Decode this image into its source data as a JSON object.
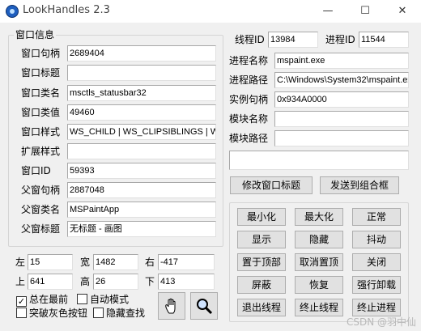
{
  "window": {
    "title": "LookHandles 2.3",
    "minimize_glyph": "—",
    "maximize_glyph": "☐",
    "close_glyph": "✕"
  },
  "window_info": {
    "legend": "窗口信息",
    "rows": [
      {
        "label": "窗口句柄",
        "value": "2689404"
      },
      {
        "label": "窗口标题",
        "value": ""
      },
      {
        "label": "窗口类名",
        "value": "msctls_statusbar32"
      },
      {
        "label": "窗口类值",
        "value": "49460"
      },
      {
        "label": "窗口样式",
        "value": "WS_CHILD | WS_CLIPSIBLINGS | WS_VISIBLE"
      },
      {
        "label": "扩展样式",
        "value": ""
      },
      {
        "label": "窗口ID",
        "value": "59393"
      },
      {
        "label": "父窗句柄",
        "value": "2887048"
      },
      {
        "label": "父窗类名",
        "value": "MSPaintApp"
      },
      {
        "label": "父窗标题",
        "value": "无标题 - 画图"
      }
    ]
  },
  "coords": {
    "left_label": "左",
    "left_value": "15",
    "width_label": "宽",
    "width_value": "1482",
    "right_label": "右",
    "right_value": "-417",
    "top_label": "上",
    "top_value": "641",
    "height_label": "高",
    "height_value": "26",
    "bottom_label": "下",
    "bottom_value": "413"
  },
  "options": {
    "always_on_top": {
      "label": "总在最前",
      "checked": true
    },
    "auto_mode": {
      "label": "自动模式",
      "checked": false
    },
    "break_gray": {
      "label": "突破灰色按钮",
      "checked": false
    },
    "hidden_search": {
      "label": "隐藏查找",
      "checked": false
    }
  },
  "tools": {
    "finder_icon": "hand-icon",
    "search_icon": "magnifier-icon"
  },
  "process": {
    "thread_id_label": "线程ID",
    "thread_id": "13984",
    "process_id_label": "进程ID",
    "process_id": "11544",
    "process_name_label": "进程名称",
    "process_name": "mspaint.exe",
    "process_path_label": "进程路径",
    "process_path": "C:\\Windows\\System32\\mspaint.exe",
    "instance_label": "实例句柄",
    "instance": "0x934A0000",
    "module_name_label": "模块名称",
    "module_name": "",
    "module_path_label": "模块路径",
    "module_path": "",
    "extra_text": ""
  },
  "actions": {
    "modify_title": "修改窗口标题",
    "send_to_combo": "发送到组合框",
    "buttons": [
      [
        "最小化",
        "最大化",
        "正常"
      ],
      [
        "显示",
        "隐藏",
        "抖动"
      ],
      [
        "置于顶部",
        "取消置顶",
        "关闭"
      ],
      [
        "屏蔽",
        "恢复",
        "强行卸载"
      ],
      [
        "退出线程",
        "终止线程",
        "终止进程"
      ]
    ]
  },
  "watermark": "CSDN @羽中仙"
}
